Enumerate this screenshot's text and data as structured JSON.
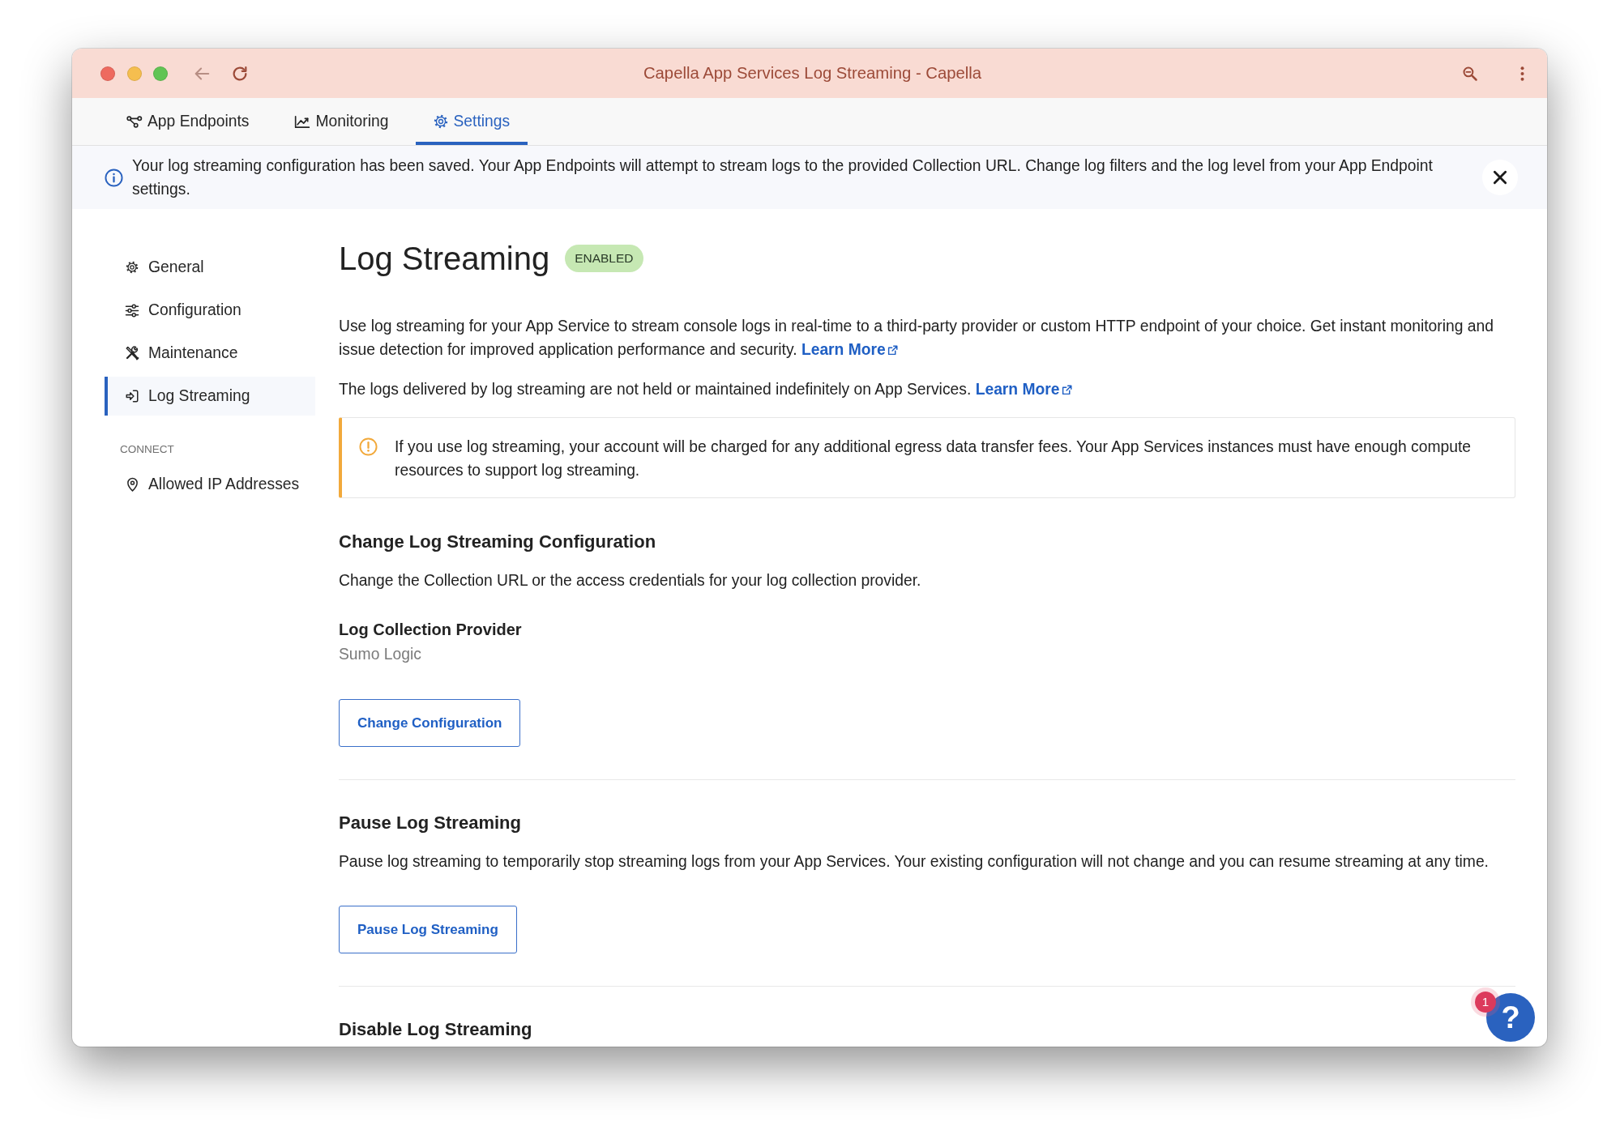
{
  "window": {
    "title": "Capella App Services Log Streaming - Capella"
  },
  "tabs": [
    {
      "label": "App Endpoints",
      "selected": false
    },
    {
      "label": "Monitoring",
      "selected": false
    },
    {
      "label": "Settings",
      "selected": true
    }
  ],
  "banner": {
    "text": "Your log streaming configuration has been saved. Your App Endpoints will attempt to stream logs to the provided Collection URL. Change log filters and the log level from your App Endpoint settings."
  },
  "sidebar": {
    "groups": [
      {
        "items": [
          {
            "label": "General",
            "selected": false
          },
          {
            "label": "Configuration",
            "selected": false
          },
          {
            "label": "Maintenance",
            "selected": false
          },
          {
            "label": "Log Streaming",
            "selected": true
          }
        ]
      },
      {
        "heading": "CONNECT",
        "items": [
          {
            "label": "Allowed IP Addresses",
            "selected": false
          }
        ]
      }
    ]
  },
  "page": {
    "title": "Log Streaming",
    "status": "ENABLED",
    "paragraphs": [
      {
        "text": "Use log streaming for your App Service to stream console logs in real-time to a third-party provider or custom HTTP endpoint of your choice. Get instant monitoring and issue detection for improved application performance and security.",
        "link": "Learn More"
      },
      {
        "text": "The logs delivered by log streaming are not held or maintained indefinitely on App Services.",
        "link": "Learn More"
      }
    ],
    "warning": "If you use log streaming, your account will be charged for any additional egress data transfer fees. Your App Services instances must have enough compute resources to support log streaming.",
    "sections": [
      {
        "title": "Change Log Streaming Configuration",
        "description": "Change the Collection URL or the access credentials for your log collection provider.",
        "fields": [
          {
            "label": "Log Collection Provider",
            "value": "Sumo Logic"
          }
        ],
        "button": "Change Configuration"
      },
      {
        "title": "Pause Log Streaming",
        "description": "Pause log streaming to temporarily stop streaming logs from your App Services. Your existing configuration will not change and you can resume streaming at any time.",
        "button": "Pause Log Streaming"
      },
      {
        "title": "Disable Log Streaming"
      }
    ]
  },
  "help": {
    "symbol": "?",
    "badge": "1"
  }
}
